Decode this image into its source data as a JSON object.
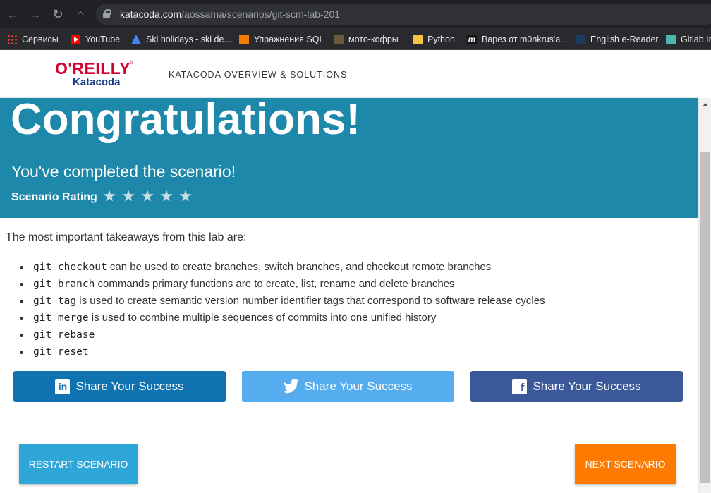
{
  "browser": {
    "url_host": "katacoda.com",
    "url_path": "/aossama/scenarios/git-scm-lab-201",
    "bookmarks": [
      "Сервисы",
      "YouTube",
      "Ski holidays - ski de...",
      "Упражнения SQL",
      "мото-кофры",
      "Python",
      "Варез от m0nkrus'a...",
      "English e-Reader",
      "Gitlab In"
    ]
  },
  "header": {
    "logo_oreilly": "O'REILLY",
    "logo_katacoda": "Katacoda",
    "nav_label": "KATACODA OVERVIEW & SOLUTIONS"
  },
  "banner": {
    "title": "Congratulations!",
    "subtitle": "You've completed the scenario!",
    "rating_label": "Scenario Rating",
    "star_count": 5
  },
  "content": {
    "intro": "The most important takeaways from this lab are:",
    "takeaways": [
      {
        "code": "git checkout",
        "text": " can be used to create branches, switch branches, and checkout remote branches"
      },
      {
        "code": "git branch",
        "text": " commands primary functions are to create, list, rename and delete branches"
      },
      {
        "code": "git tag",
        "text": " is used to create semantic version number identifier tags that correspond to software release cycles"
      },
      {
        "code": "git merge",
        "text": " is used to combine multiple sequences of commits into one unified history"
      },
      {
        "code": "git rebase",
        "text": ""
      },
      {
        "code": "git reset",
        "text": ""
      }
    ]
  },
  "share": {
    "linkedin_label": "Share Your Success",
    "twitter_label": "Share Your Success",
    "facebook_label": "Share Your Success"
  },
  "actions": {
    "restart_label": "RESTART SCENARIO",
    "next_label": "NEXT SCENARIO"
  },
  "colors": {
    "banner": "#1d88a9",
    "linkedin": "#0e73b0",
    "twitter": "#55acee",
    "facebook": "#3b5998",
    "restart": "#2ea6d8",
    "next": "#ff7a00"
  }
}
